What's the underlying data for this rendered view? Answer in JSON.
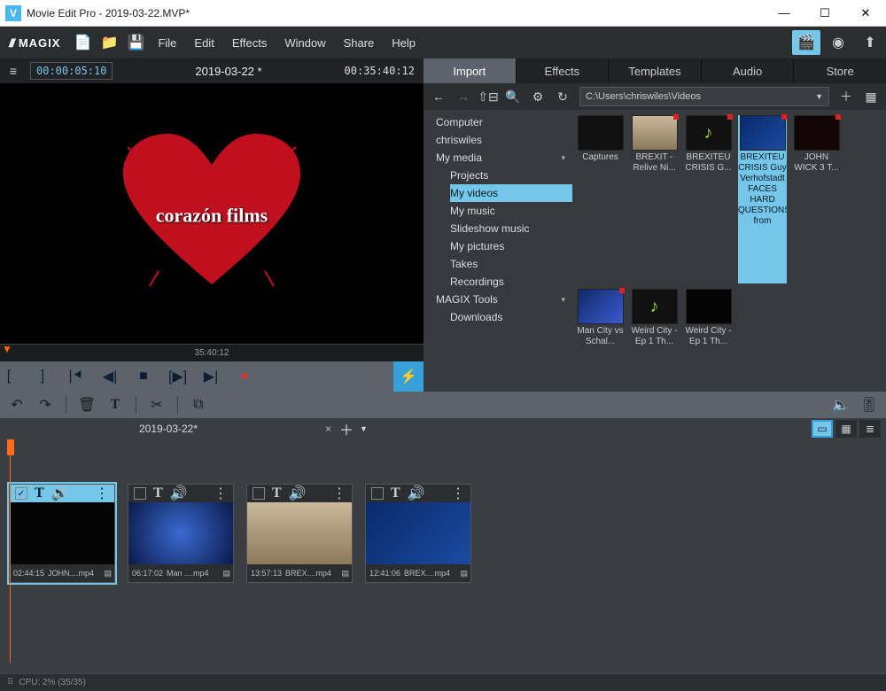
{
  "window": {
    "title": "Movie Edit Pro - 2019-03-22.MVP*",
    "app_icon_letter": "V"
  },
  "brand": "MAGIX",
  "menus": [
    "File",
    "Edit",
    "Effects",
    "Window",
    "Share",
    "Help"
  ],
  "infobar": {
    "tc_in": "00:00:05:10",
    "project": "2019-03-22 *",
    "tc_out": "00:35:40:12"
  },
  "preview": {
    "logo_text": "corazón films",
    "ruler_center": "35:40:12"
  },
  "tabs": [
    "Import",
    "Effects",
    "Templates",
    "Audio",
    "Store"
  ],
  "browser_path": "C:\\Users\\chriswiles\\Videos",
  "tree": {
    "root": [
      "Computer",
      "chriswiles"
    ],
    "mymedia": "My media",
    "mymedia_items": [
      "Projects",
      "My videos",
      "My music",
      "Slideshow music",
      "My pictures",
      "Takes",
      "Recordings"
    ],
    "magix_tools": "MAGIX Tools",
    "magix_items": [
      "Downloads"
    ]
  },
  "thumbs": [
    {
      "name": "Captures",
      "type": "folder"
    },
    {
      "name": "BREXIT - Relive Ni...",
      "type": "video",
      "flag": true
    },
    {
      "name": "BREXITEU CRISIS G...",
      "type": "audio",
      "flag": true
    },
    {
      "name": "BREXITEU CRISIS Guy Verhofstadt FACES HARD QUESTIONS from",
      "type": "video",
      "flag": true,
      "selected": true
    },
    {
      "name": "JOHN WICK 3 T...",
      "type": "video",
      "flag": true
    },
    {
      "name": "Man City vs Schal...",
      "type": "video",
      "flag": true
    },
    {
      "name": "Weird City - Ep 1 Th...",
      "type": "audio"
    },
    {
      "name": "Weird City - Ep 1 Th...",
      "type": "video"
    }
  ],
  "project_tab": "2019-03-22*",
  "clips": [
    {
      "tc": "02:44:15",
      "fn": "JOHN....mp4",
      "selected": true,
      "checked": true
    },
    {
      "tc": "06:17:02",
      "fn": "Man ....mp4"
    },
    {
      "tc": "13:57:13",
      "fn": "BREX....mp4"
    },
    {
      "tc": "12:41:06",
      "fn": "BREX....mp4"
    }
  ],
  "status": "CPU: 2% (35/35)"
}
